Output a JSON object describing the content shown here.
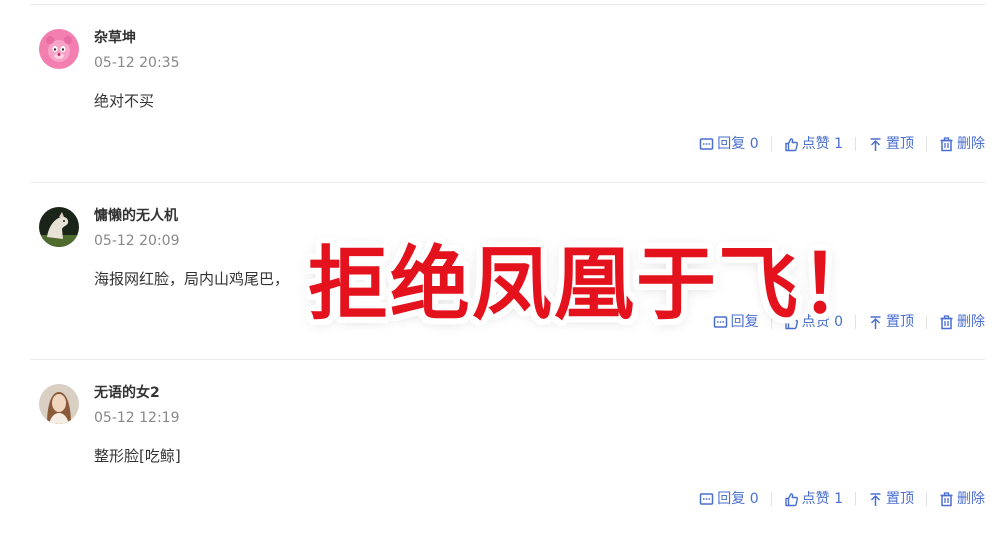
{
  "comments": [
    {
      "username": "杂草坤",
      "time": "05-12 20:35",
      "content": "绝对不买",
      "reply_label": "回复 0",
      "like_label": "点赞 1",
      "pin_label": "置顶",
      "delete_label": "删除"
    },
    {
      "username": "慵懒的无人机",
      "time": "05-12 20:09",
      "content": "海报网红脸，局内山鸡尾巴，",
      "reply_label": "回复",
      "like_label": "点赞 0",
      "pin_label": "置顶",
      "delete_label": "删除"
    },
    {
      "username": "无语的女2",
      "time": "05-12 12:19",
      "content": "整形脸[吃鲸]",
      "reply_label": "回复 0",
      "like_label": "点赞 1",
      "pin_label": "置顶",
      "delete_label": "删除"
    }
  ],
  "overlay": {
    "text": "拒绝凤凰于飞！"
  },
  "colors": {
    "action_blue": "#4a6fcf",
    "overlay_red": "#e3121c"
  }
}
